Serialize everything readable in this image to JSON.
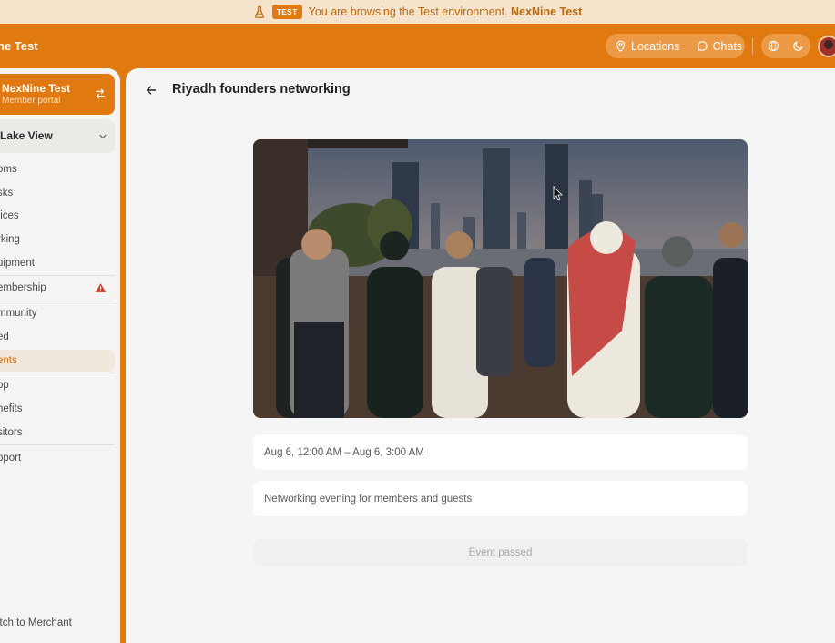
{
  "banner": {
    "badge": "TEST",
    "text": "You are browsing the Test environment.",
    "env_name": "NexNine Test"
  },
  "header": {
    "brand": "ne Test",
    "nav": [
      {
        "label": "Locations",
        "icon": "map-pin-icon"
      },
      {
        "label": "Chats",
        "icon": "chat-icon"
      }
    ],
    "tools": [
      {
        "icon": "globe-icon"
      },
      {
        "icon": "moon-icon"
      }
    ]
  },
  "sidebar": {
    "account": {
      "name": "NexNine Test",
      "subtitle": "Member portal",
      "icon": "switch-icon"
    },
    "location": {
      "label": "Lake View",
      "icon": "chevron-down-icon"
    },
    "items": [
      {
        "label": "oms"
      },
      {
        "label": "sks"
      },
      {
        "label": "fices"
      },
      {
        "label": "rking"
      },
      {
        "label": "uipment"
      },
      {
        "label": "embership"
      },
      {
        "label": "mmunity"
      },
      {
        "label": "ed"
      },
      {
        "label": "ents"
      },
      {
        "label": "op"
      },
      {
        "label": "nefits"
      },
      {
        "label": "sitors"
      },
      {
        "label": "pport"
      }
    ],
    "footer": "itch to Merchant"
  },
  "event": {
    "title": "Riyadh founders networking",
    "datetime": "Aug 6, 12:00 AM – Aug 6, 3:00 AM",
    "description": "Networking evening for members and guests",
    "status": "Event passed"
  },
  "colors": {
    "brand": "#e07a10",
    "banner_bg": "#f6e3cc",
    "warning": "#d9342b"
  }
}
